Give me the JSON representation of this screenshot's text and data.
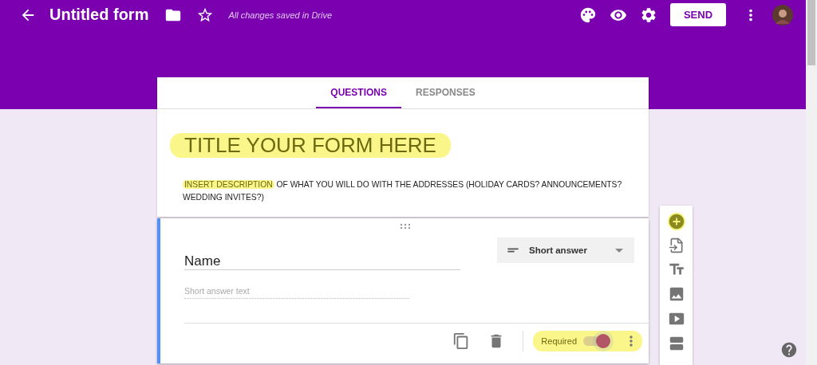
{
  "header": {
    "title": "Untitled form",
    "save_status": "All changes saved in Drive",
    "send_button": "SEND"
  },
  "tabs": [
    {
      "label": "QUESTIONS",
      "selected": true
    },
    {
      "label": "RESPONSES",
      "selected": false
    }
  ],
  "form_header": {
    "title": "TITLE YOUR FORM HERE",
    "title_highlighted": true,
    "description_highlight": "INSERT DESCRIPTION",
    "description_rest": " OF WHAT YOU WILL DO WITH THE ADDRESSES (HOLIDAY CARDS? ANNOUNCEMENTS? WEDDING INVITES?)"
  },
  "question": {
    "title": "Name",
    "type": "Short answer",
    "answer_placeholder": "Short answer text",
    "required": {
      "label": "Required",
      "on": true,
      "highlighted": true
    }
  },
  "side_toolbar": {
    "add_highlighted": true
  }
}
